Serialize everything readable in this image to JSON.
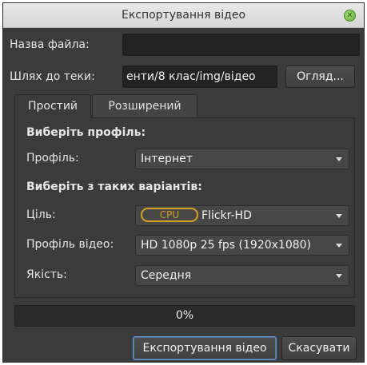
{
  "window": {
    "title": "Експортування відео"
  },
  "filename": {
    "label": "Назва файла:",
    "value": ""
  },
  "path": {
    "label": "Шлях до теки:",
    "value": "енти/8 клас/img/відео",
    "browse_label": "Огляд..."
  },
  "tabs": [
    {
      "label": "Простий",
      "active": true
    },
    {
      "label": "Розширений",
      "active": false
    }
  ],
  "simple": {
    "profile_heading": "Виберіть профіль:",
    "profile_label": "Профіль:",
    "profile_value": "Інтернет",
    "options_heading": "Виберіть з таких варіантів:",
    "target_label": "Ціль:",
    "target_badge": "CPU",
    "target_value": "Flickr-HD",
    "video_profile_label": "Профіль відео:",
    "video_profile_value": "HD 1080p 25 fps (1920x1080)",
    "quality_label": "Якість:",
    "quality_value": "Середня"
  },
  "progress": {
    "value": 0,
    "text": "0%"
  },
  "actions": {
    "export_label": "Експортування відео",
    "cancel_label": "Скасувати"
  },
  "colors": {
    "window_bg": "#3b3b3b",
    "field_bg": "#232323",
    "badge": "#d4a01e",
    "focus": "#6a98c8",
    "close_button": "#7cc24d"
  },
  "icons": {
    "close": "close-icon",
    "dropdown": "chevron-down-icon"
  }
}
